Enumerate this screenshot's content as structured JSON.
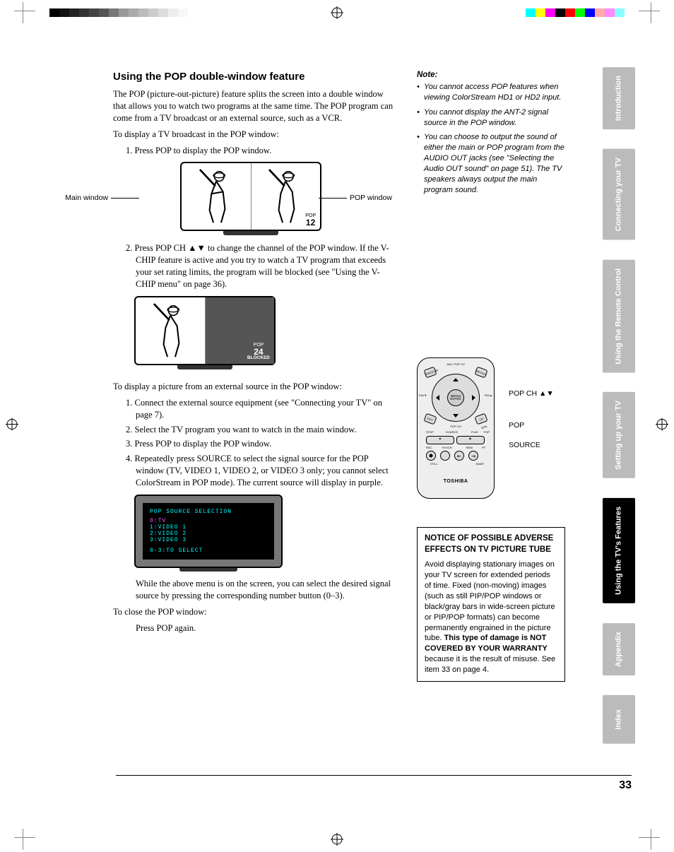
{
  "heading": "Using the POP double-window feature",
  "intro": "The POP (picture-out-picture) feature splits the screen into a double window that allows you to watch two programs at the same time. The POP program can come from a TV broadcast or an external source, such as a VCR.",
  "broadcast_lead": "To display a TV broadcast in the POP window:",
  "step1": "1. Press POP to display the POP window.",
  "diagram1": {
    "main_label": "Main window",
    "pop_label": "POP window",
    "pop_tag": "POP",
    "pop_ch": "12"
  },
  "step2": "2. Press POP CH ▲▼ to change the channel of the POP window. If the V-CHIP feature is active and you try to watch a TV program that exceeds your set rating limits, the program will be blocked (see \"Using the V-CHIP menu\" on page 36).",
  "diagram2": {
    "pop_tag": "POP",
    "pop_ch": "24",
    "blocked": "BLOCKED"
  },
  "ext_lead": "To display a picture from an external source in the POP window:",
  "ext_steps": [
    "1. Connect the external source equipment (see \"Connecting your TV\" on page 7).",
    "2. Select the TV program you want to watch in the main window.",
    "3. Press POP to display the POP window.",
    "4. Repeatedly press SOURCE to select the signal source for the POP window (TV, VIDEO 1, VIDEO 2, or VIDEO 3 only; you cannot select ColorStream in POP mode). The current source will display in purple."
  ],
  "source_menu": {
    "title": "POP SOURCE SELECTION",
    "rows": [
      "0:TV",
      "1:VIDEO 1",
      "2:VIDEO 2",
      "3:VIDEO 3"
    ],
    "footer": "0-3:TO SELECT"
  },
  "source_caption": "While the above menu is on the screen, you can select the desired signal source by pressing the corresponding number button (0–3).",
  "close_lead": "To close the POP window:",
  "close_step": "Press POP again.",
  "note": {
    "title": "Note:",
    "items": [
      "You cannot access POP features when viewing ColorStream HD1 or HD2 input.",
      "You cannot display the ANT-2 signal source in the POP window.",
      "You can choose to output the sound of either the main or POP program from the AUDIO OUT jacks (see \"Selecting the Audio OUT sound\" on page 51). The TV speakers always output the main program sound."
    ]
  },
  "remote": {
    "labels": {
      "popch": "POP CH ▲▼",
      "pop": "POP",
      "source": "SOURCE"
    },
    "brand": "TOSHIBA",
    "btns": {
      "adv_popch": "ADV.\nPOP CH",
      "recall": "RECALL",
      "favscan": "FAVSCAN",
      "fav_left": "FAV▼",
      "fav_right": "FAV▲",
      "menu": "MENU/\nENTER",
      "exit": "EXIT",
      "popch_dn": "POP CH",
      "chrtn": "CH RTN",
      "stop": "STOP",
      "source_btn": "SOURCE",
      "play": "PLAY",
      "pop_btn": "POP",
      "rec": "REC",
      "tvvcr": "TV/VCR",
      "rew": "REW",
      "ff": "FF",
      "still": "STILL",
      "swap": "SWAP"
    }
  },
  "notice": {
    "title": "NOTICE OF POSSIBLE ADVERSE EFFECTS ON TV PICTURE TUBE",
    "body_pre": "Avoid displaying stationary images on your TV screen for extended periods of time. Fixed (non-moving) images (such as still PIP/POP windows or black/gray bars in wide-screen picture or PIP/POP formats) can become permanently engrained in the picture tube. ",
    "body_bold": "This type of damage is NOT COVERED BY YOUR WARRANTY",
    "body_post": " because it is the result of misuse. See item 33 on page 4."
  },
  "tabs": [
    "Introduction",
    "Connecting your TV",
    "Using the Remote Control",
    "Setting up your TV",
    "Using the TV's Features",
    "Appendix",
    "Index"
  ],
  "active_tab_index": 4,
  "page_number": "33"
}
